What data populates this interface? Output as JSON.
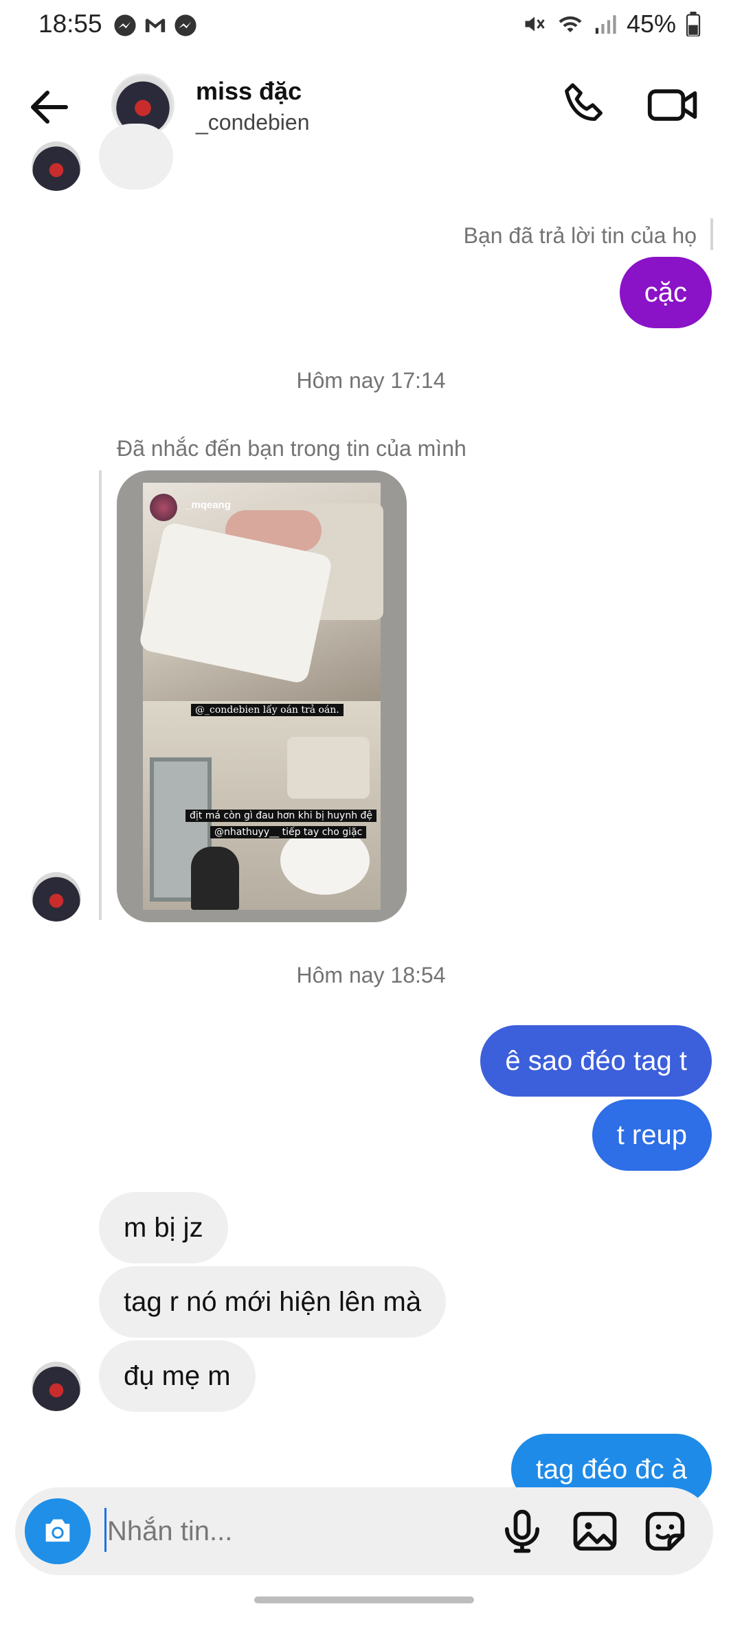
{
  "status_bar": {
    "time": "18:55",
    "battery": "45%",
    "icons_left": [
      "messenger-icon",
      "gmail-icon",
      "messenger-icon"
    ],
    "icons_right": [
      "mute-icon",
      "wifi-icon",
      "signal-icon",
      "battery-icon"
    ]
  },
  "header": {
    "name": "miss đặc",
    "username": "_condebien"
  },
  "messages": {
    "reply_note": "Bạn đã trả lời tin của họ",
    "out_1": "cặc",
    "timestamp_1": "Hôm nay 17:14",
    "mention_note": "Đã nhắc đến bạn trong tin của mình",
    "story": {
      "user": "_mqeang",
      "caption_1": "@_condebien lấy oán trả oán.",
      "caption_2": "địt má còn gì đau hơn khi bị huynh đệ",
      "caption_3": "@nhathuyy__ tiếp tay cho giặc"
    },
    "timestamp_2": "Hôm nay 18:54",
    "out_2": "ê sao đéo tag t",
    "out_3": "t reup",
    "in_1": "m bị jz",
    "in_2": "tag r nó mới hiện lên mà",
    "in_3": "đụ mẹ m",
    "out_4": "tag đéo đc à"
  },
  "composer": {
    "placeholder": "Nhắn tin..."
  },
  "colors": {
    "purple": "#8a12c7",
    "blue": "#3c5fdc",
    "cyan": "#1f8be8",
    "incoming": "#efefef"
  }
}
